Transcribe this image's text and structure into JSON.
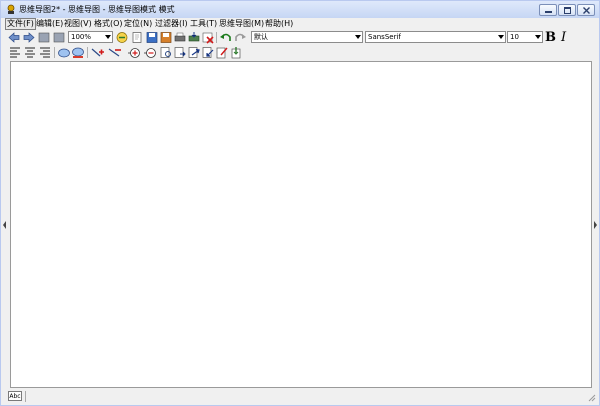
{
  "window": {
    "title": "思维导图2* - 思维导图 - 思维导图模式 模式",
    "app_icon": "app-icon",
    "buttons": [
      "minimize-icon",
      "maximize-icon",
      "close-icon"
    ]
  },
  "menubar": {
    "items": [
      {
        "label": "文件(F)"
      },
      {
        "label": "编辑(E)"
      },
      {
        "label": "视图(V)"
      },
      {
        "label": "格式(O)"
      },
      {
        "label": "定位(N)"
      },
      {
        "label": "过滤器(I)"
      },
      {
        "label": "工具(T)"
      },
      {
        "label": "思维导图(M)"
      },
      {
        "label": "帮助(H)"
      }
    ]
  },
  "toolbar": {
    "zoom_value": "100%",
    "style_value": "默认",
    "font_value": "SansSerif",
    "size_value": "10",
    "bold_label": "B",
    "italic_label": "I"
  },
  "statusbar": {
    "spell_label": "Abc"
  },
  "colors": {
    "titlebar_top": "#dfe9fb",
    "titlebar_bottom": "#c6d6f4",
    "chrome": "#f0f0f0",
    "canvas": "#ffffff"
  }
}
